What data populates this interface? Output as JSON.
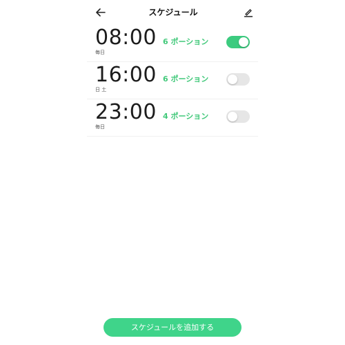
{
  "header": {
    "title": "スケジュール",
    "back_icon": "arrow-left-icon",
    "edit_icon": "pencil-icon"
  },
  "schedules": [
    {
      "time": "08:00",
      "days": "毎日",
      "portion": "6 ポーション",
      "enabled": true
    },
    {
      "time": "16:00",
      "days": "日 土",
      "portion": "6 ポーション",
      "enabled": false
    },
    {
      "time": "23:00",
      "days": "毎日",
      "portion": "4 ポーション",
      "enabled": false
    }
  ],
  "add_button": {
    "label": "スケジュールを追加する"
  },
  "colors": {
    "accent": "#3fd48a",
    "portion_text": "#43c97b",
    "toggle_off": "#e6e6e6"
  }
}
